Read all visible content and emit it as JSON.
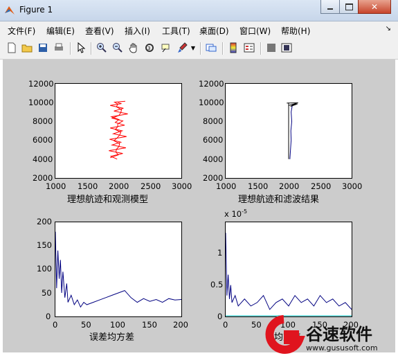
{
  "window": {
    "title": "Figure 1"
  },
  "menu": [
    "文件(F)",
    "编辑(E)",
    "查看(V)",
    "插入(I)",
    "工具(T)",
    "桌面(D)",
    "窗口(W)",
    "帮助(H)"
  ],
  "toolbar_icons": [
    "new-file-icon",
    "open-folder-icon",
    "save-icon",
    "print-icon",
    "pointer-icon",
    "zoom-in-icon",
    "zoom-out-icon",
    "pan-hand-icon",
    "rotate-3d-icon",
    "data-cursor-icon",
    "brush-icon",
    "brush-dropdown-icon",
    "link-plot-icon",
    "colorbar-icon",
    "legend-icon",
    "hide-plot-tools-icon",
    "show-plot-tools-icon"
  ],
  "plots": [
    {
      "xlabel": "理想航迹和观测模型",
      "xticks": [
        "1000",
        "1500",
        "2000",
        "2500",
        "3000"
      ],
      "yticks": [
        "12000",
        "10000",
        "8000",
        "6000",
        "4000",
        "2000"
      ]
    },
    {
      "xlabel": "理想航迹和滤波结果",
      "xticks": [
        "1000",
        "1500",
        "2000",
        "2500",
        "3000"
      ],
      "yticks": [
        "12000",
        "10000",
        "8000",
        "6000",
        "4000",
        "2000"
      ]
    },
    {
      "xlabel": "误差均方差",
      "xticks": [
        "0",
        "50",
        "100",
        "150",
        "200"
      ],
      "yticks": [
        "200",
        "150",
        "100",
        "50",
        "0"
      ]
    },
    {
      "xlabel": "均方差",
      "xticks": [
        "0",
        "50",
        "100",
        "150",
        "200"
      ],
      "yticks": [
        "1",
        "0.5",
        "0"
      ],
      "exponent_base": "x 10",
      "exponent_power": "-5"
    }
  ],
  "watermark": {
    "brand": "谷速软件",
    "url": "www.gususoft.com"
  },
  "chart_data": [
    {
      "type": "line",
      "xlim": [
        1000,
        3000
      ],
      "ylim": [
        2000,
        12000
      ],
      "series": [
        {
          "color": "#ff0000",
          "x": [
            1980,
            1880,
            2070,
            1850,
            2120,
            1900,
            2040,
            1860,
            2130,
            1920,
            2060,
            1870,
            2100,
            1950,
            2010,
            1890,
            2150,
            1930,
            2080,
            1870,
            2050,
            1990
          ],
          "y": [
            4000,
            4300,
            4600,
            4900,
            5200,
            5500,
            5800,
            6100,
            6400,
            6700,
            7000,
            7300,
            7600,
            7900,
            8200,
            8500,
            8800,
            9100,
            9400,
            9700,
            9900,
            10000
          ]
        }
      ]
    },
    {
      "type": "line",
      "xlim": [
        1000,
        3000
      ],
      "ylim": [
        2000,
        12000
      ],
      "series": [
        {
          "color": "#000000",
          "x": [
            2000,
            2000,
            2000
          ],
          "y": [
            4000,
            7000,
            10000
          ]
        },
        {
          "color": "#000080",
          "x": [
            2020,
            2030,
            2040,
            2035,
            2050,
            2040,
            2060
          ],
          "y": [
            4000,
            5000,
            6000,
            7000,
            8000,
            9000,
            9800
          ]
        }
      ]
    },
    {
      "type": "line",
      "xlim": [
        0,
        200
      ],
      "ylim": [
        0,
        200
      ],
      "series": [
        {
          "color": "#000080",
          "x": [
            0,
            2,
            4,
            6,
            8,
            10,
            12,
            15,
            18,
            20,
            25,
            30,
            35,
            40,
            45,
            50,
            60,
            70,
            80,
            90,
            100,
            110,
            120,
            130,
            140,
            150,
            160,
            170,
            180,
            190,
            200
          ],
          "y": [
            180,
            60,
            140,
            80,
            120,
            50,
            95,
            40,
            70,
            30,
            45,
            25,
            35,
            20,
            30,
            25,
            30,
            35,
            40,
            45,
            50,
            55,
            40,
            30,
            38,
            32,
            36,
            30,
            38,
            35,
            36
          ]
        }
      ]
    },
    {
      "type": "line",
      "xlim": [
        0,
        200
      ],
      "ylim": [
        0,
        1.35
      ],
      "y_scale_note": "x 10^-5",
      "series": [
        {
          "color": "#000080",
          "x": [
            0,
            2,
            4,
            6,
            8,
            10,
            15,
            20,
            30,
            40,
            50,
            60,
            70,
            80,
            90,
            100,
            110,
            120,
            130,
            140,
            150,
            160,
            170,
            180,
            190,
            200
          ],
          "y": [
            1.2,
            0.3,
            0.6,
            0.25,
            0.45,
            0.2,
            0.3,
            0.15,
            0.25,
            0.15,
            0.2,
            0.3,
            0.1,
            0.2,
            0.25,
            0.15,
            0.3,
            0.2,
            0.25,
            0.15,
            0.3,
            0.2,
            0.25,
            0.15,
            0.2,
            0.1
          ]
        }
      ]
    }
  ]
}
